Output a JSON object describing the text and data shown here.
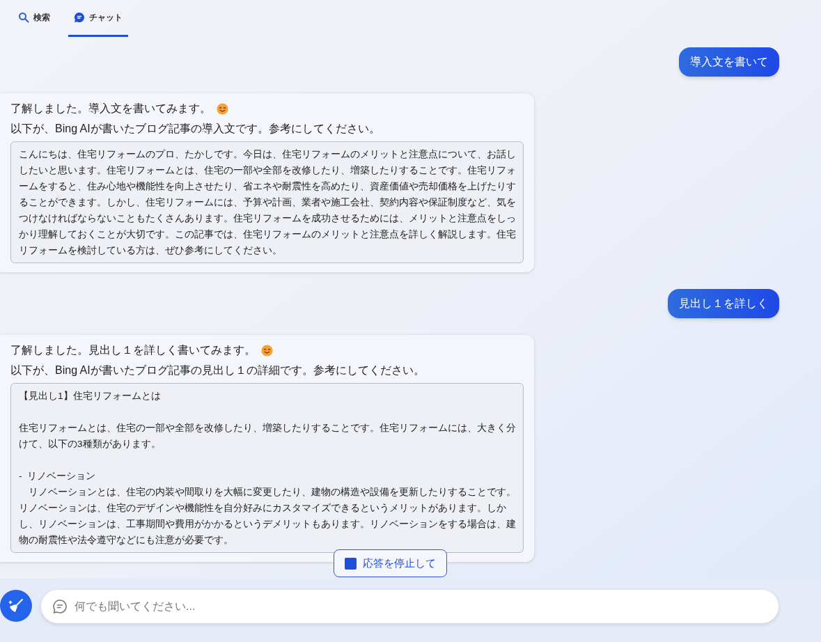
{
  "tabs": [
    {
      "label": "検索",
      "kind": "search",
      "selected": false
    },
    {
      "label": "チャット",
      "kind": "chat",
      "selected": true
    }
  ],
  "messages": [
    {
      "kind": "user",
      "text": "導入文を書いて"
    },
    {
      "kind": "bot",
      "intro": "了解しました。導入文を書いてみます。",
      "emoji": true,
      "lead": "以下が、Bing AIが書いたブログ記事の導入文です。参考にしてください。",
      "paragraphs": [
        [
          "こんにちは、住宅リフォームのプロ、たかしです。今日は、住宅リフォームのメリットと注意点について、お話ししたいと思います。住宅リフォームとは、住宅の一部や全部を改修したり、増築したりすることです。住宅リフォームをすると、住み心地や機能性を向上させたり、省エネや耐震性を高めたり、資産価値や売却価格を上げたりすることができます。しかし、住宅リフォームには、予算や計画、業者や施工会社、契約内容や保証制度など、気をつけなければならないこともたくさんあります。住宅リフォームを成功させるためには、メリットと注意点をしっかり理解しておくことが大切です。この記事では、住宅リフォームのメリットと注意点を詳しく解説します。住宅リフォームを検討している方は、ぜひ参考にしてください。"
        ]
      ]
    },
    {
      "kind": "user",
      "text": "見出し１を詳しく"
    },
    {
      "kind": "bot",
      "intro": "了解しました。見出し１を詳しく書いてみます。",
      "emoji": true,
      "lead": "以下が、Bing AIが書いたブログ記事の見出し１の詳細です。参考にしてください。",
      "paragraphs": [
        [
          "【見出し1】住宅リフォームとは"
        ],
        [
          "住宅リフォームとは、住宅の一部や全部を改修したり、増築したりすることです。住宅リフォームには、大きく分けて、以下の3種類があります。"
        ],
        [
          "-  リノベーション",
          "　リノベーションとは、住宅の内装や間取りを大幅に変更したり、建物の構造や設備を更新したりすることです。リノベーションは、住宅のデザインや機能性を自分好みにカスタマイズできるというメリットがあります。しかし、リノベーションは、工事期間や費用がかかるというデメリットもあります。リノベーションをする場合は、建物の耐震性や法令遵守などにも注意が必要です。"
        ]
      ]
    }
  ],
  "stop_button": "応答を停止して",
  "input": {
    "placeholder": "何でも聞いてください..."
  }
}
